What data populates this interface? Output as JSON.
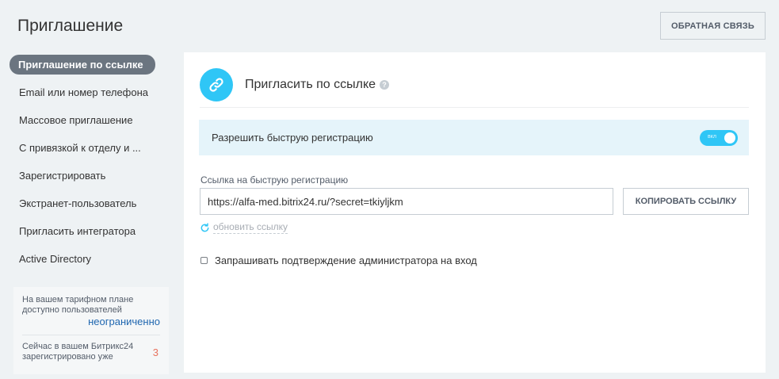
{
  "page": {
    "title": "Приглашение",
    "feedback_button": "Обратная связь"
  },
  "sidebar": {
    "items": [
      {
        "label": "Приглашение по ссылке",
        "active": true
      },
      {
        "label": "Email или номер телефона"
      },
      {
        "label": "Массовое приглашение"
      },
      {
        "label": "С привязкой к отделу и ..."
      },
      {
        "label": "Зарегистрировать"
      },
      {
        "label": "Экстранет-пользователь"
      },
      {
        "label": "Пригласить интегратора"
      },
      {
        "label": "Active Directory"
      }
    ]
  },
  "tariff": {
    "plan_text": "На вашем тарифном плане доступно пользователей",
    "plan_value": "неограниченно",
    "registered_text": "Сейчас в вашем Битрикс24 зарегистрировано уже",
    "registered_count": "3"
  },
  "card": {
    "title": "Пригласить по ссылке",
    "fast_registration_label": "Разрешить быструю регистрацию",
    "toggle_text": "вкл",
    "toggle_on": true,
    "link_label": "Ссылка на быструю регистрацию",
    "link_value": "https://alfa-med.bitrix24.ru/?secret=tkiyljkm",
    "copy_button": "Копировать ссылку",
    "refresh_link": "обновить ссылку",
    "confirm_label": "Запрашивать подтверждение администратора на вход",
    "confirm_checked": false
  },
  "colors": {
    "accent": "#2fc6f6",
    "active_nav": "#6b7580",
    "highlight_bg": "#e5f4fa"
  }
}
